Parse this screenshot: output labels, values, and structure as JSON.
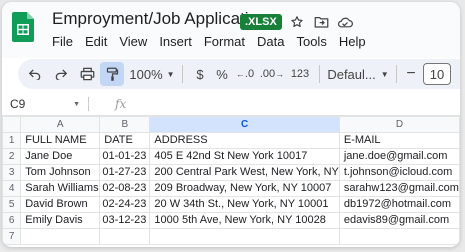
{
  "app": {
    "title": "Emproyment/Job Application",
    "badge": ".XLSX",
    "menu": [
      "File",
      "Edit",
      "View",
      "Insert",
      "Format",
      "Data",
      "Tools",
      "Help"
    ]
  },
  "toolbar": {
    "zoom": "100%",
    "currency": "$",
    "percent": "%",
    "dec_decrease": ".0",
    "dec_increase": ".00",
    "number_format": "123",
    "font": "Defaul...",
    "font_size": "10"
  },
  "formula_bar": {
    "cell_ref": "C9",
    "fx": "fx",
    "value": ""
  },
  "sheet": {
    "columns": [
      "A",
      "B",
      "C",
      "D"
    ],
    "selected_column": "C",
    "row_numbers": [
      "1",
      "2",
      "3",
      "4",
      "5",
      "6",
      "7"
    ],
    "rows": [
      [
        "FULL NAME",
        "DATE",
        "ADDRESS",
        "E-MAIL"
      ],
      [
        "Jane Doe",
        "01-01-23",
        "405 E 42nd St New York 10017",
        "jane.doe@gmail.com"
      ],
      [
        "Tom Johnson",
        "01-27-23",
        "200 Central Park West, New York, NY",
        "t.johnson@icloud.com"
      ],
      [
        "Sarah Williams",
        "02-08-23",
        "209 Broadway, New York, NY 10007",
        "sarahw123@gmail.com"
      ],
      [
        "David Brown",
        "02-24-23",
        "20 W 34th St., New York, NY 10001",
        "db1972@hotmail.com"
      ],
      [
        "Emily Davis",
        "03-12-23",
        "1000 5th Ave, New York, NY 10028",
        "edavis89@gmail.com"
      ],
      [
        "",
        "",
        "",
        ""
      ]
    ]
  },
  "colors": {
    "accent": "#188038",
    "selection": "#d3e3fd",
    "toolbar_bg": "#eef2f8"
  }
}
